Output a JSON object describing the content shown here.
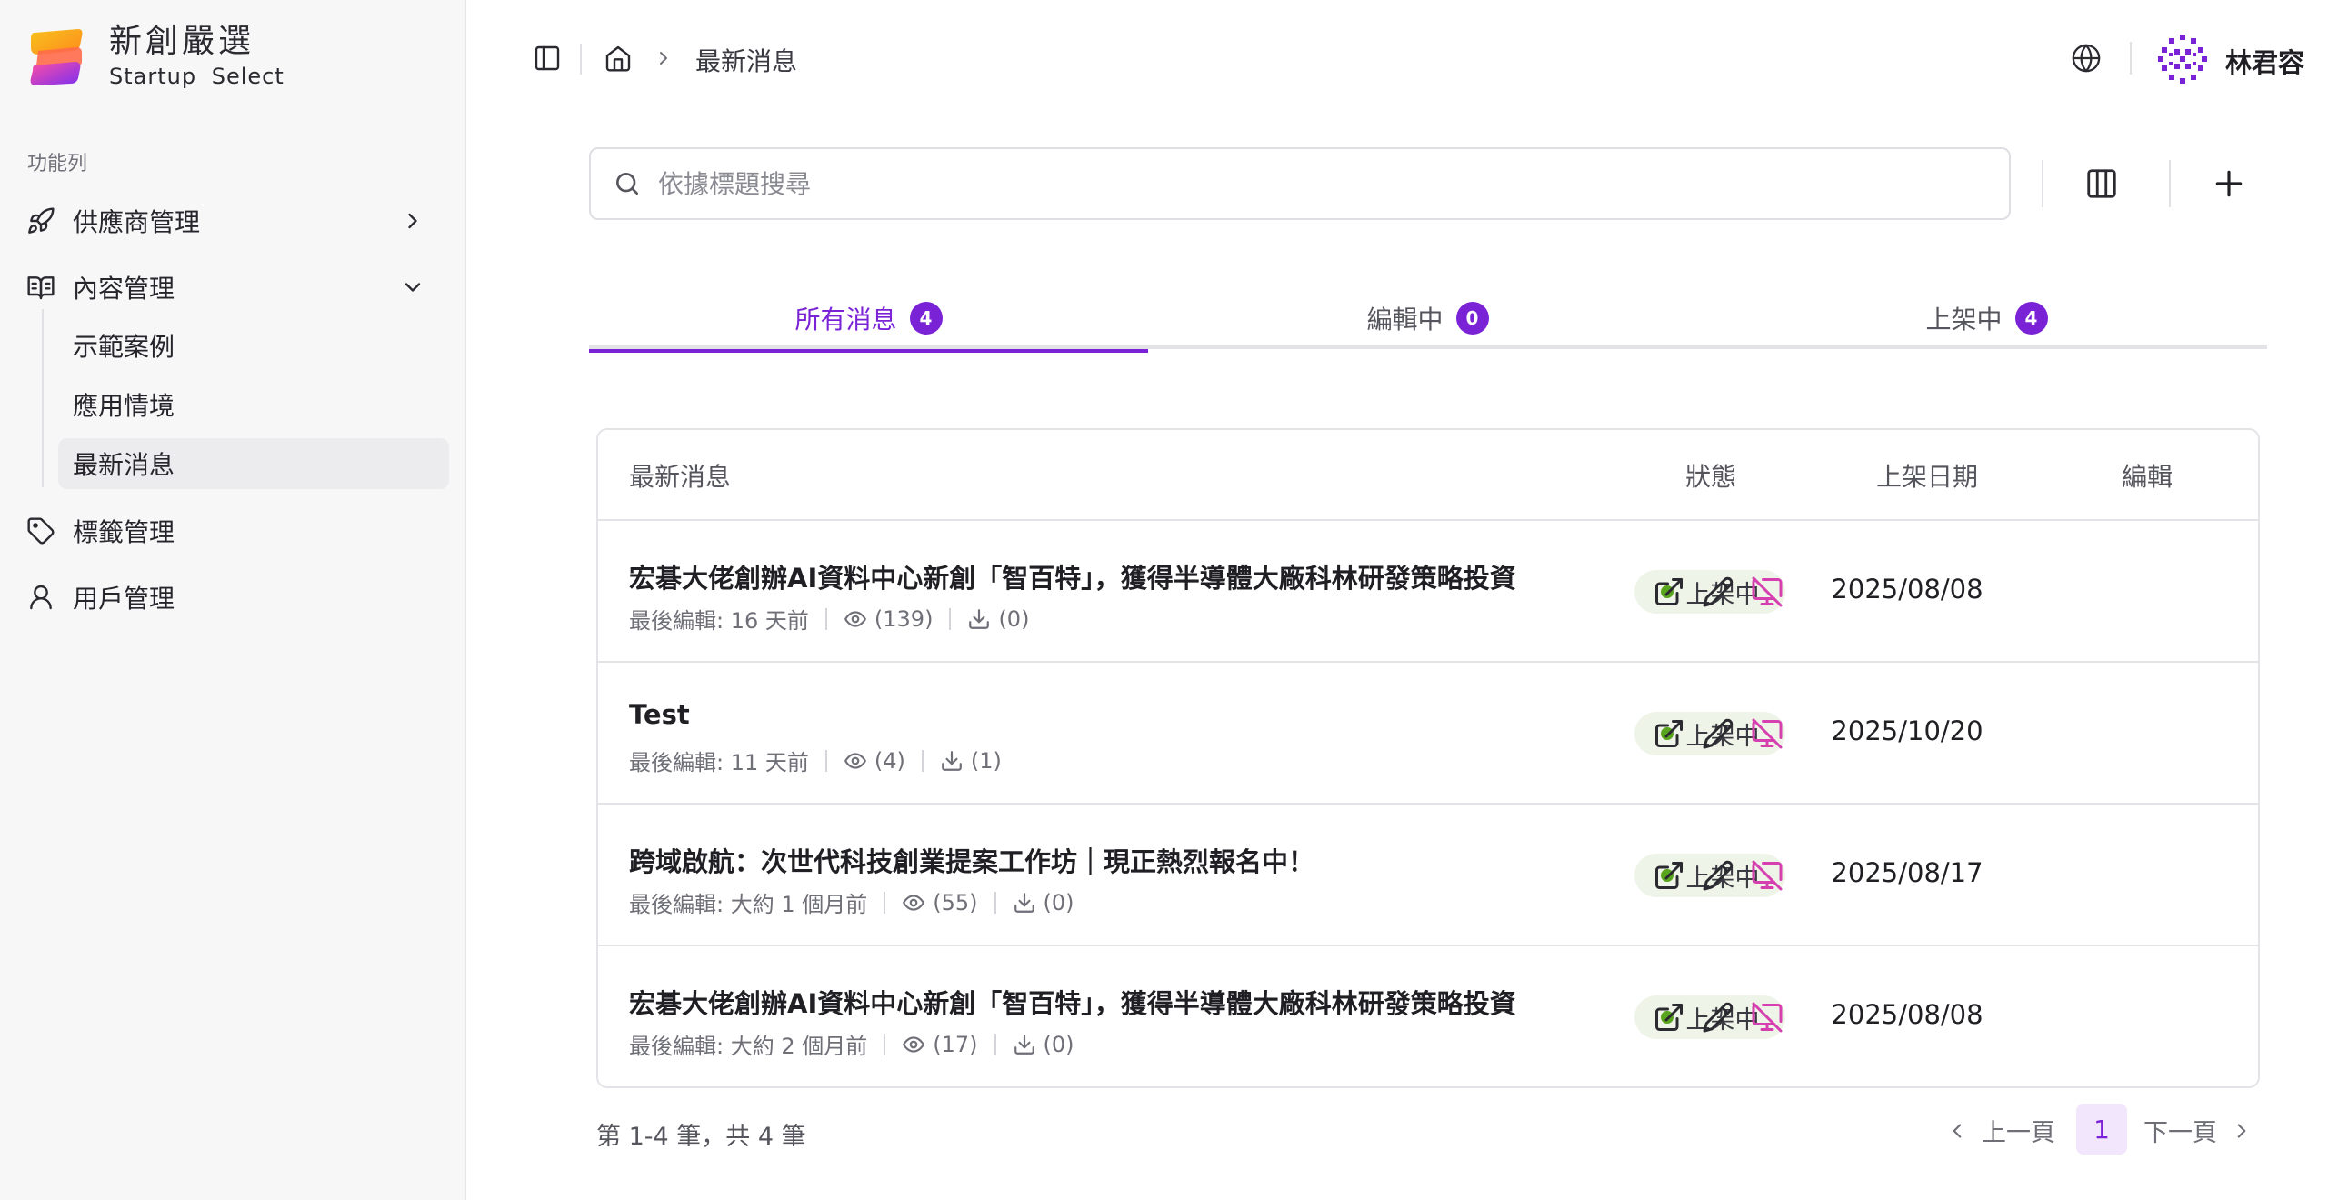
{
  "brand": {
    "name_cn": "新創嚴選",
    "name_en": "Startup  Select"
  },
  "sidebar": {
    "section_label": "功能列",
    "items": [
      {
        "label": "供應商管理",
        "icon": "rocket-icon",
        "expanded": false
      },
      {
        "label": "內容管理",
        "icon": "book-icon",
        "expanded": true,
        "children": [
          {
            "label": "示範案例"
          },
          {
            "label": "應用情境"
          },
          {
            "label": "最新消息",
            "active": true
          }
        ]
      },
      {
        "label": "標籤管理",
        "icon": "tag-icon"
      },
      {
        "label": "用戶管理",
        "icon": "user-icon"
      }
    ]
  },
  "header": {
    "breadcrumb": "最新消息",
    "user_name": "林君容"
  },
  "search": {
    "placeholder": "依據標題搜尋",
    "value": ""
  },
  "tabs": [
    {
      "label": "所有消息",
      "count": "4",
      "active": true
    },
    {
      "label": "編輯中",
      "count": "0",
      "active": false
    },
    {
      "label": "上架中",
      "count": "4",
      "active": false
    }
  ],
  "table": {
    "columns": [
      "最新消息",
      "狀態",
      "上架日期",
      "編輯"
    ],
    "meta_prefix": "最後編輯: ",
    "rows": [
      {
        "title": "宏碁大佬創辦AI資料中心新創「智百特」，獲得半導體大廠科林研發策略投資",
        "edited": "16 天前",
        "views": "(139)",
        "downloads": "(0)",
        "status": "上架中",
        "date": "2025/08/08"
      },
      {
        "title": "Test",
        "edited": "11 天前",
        "views": "(4)",
        "downloads": "(1)",
        "status": "上架中",
        "date": "2025/10/20"
      },
      {
        "title": "跨域啟航：次世代科技創業提案工作坊｜現正熱烈報名中！",
        "edited": "大約 1 個月前",
        "views": "(55)",
        "downloads": "(0)",
        "status": "上架中",
        "date": "2025/08/17"
      },
      {
        "title": "宏碁大佬創辦AI資料中心新創「智百特」，獲得半導體大廠科林研發策略投資",
        "edited": "大約 2 個月前",
        "views": "(17)",
        "downloads": "(0)",
        "status": "上架中",
        "date": "2025/08/08"
      }
    ]
  },
  "footer": {
    "summary": "第 1-4 筆，共 4 筆",
    "prev": "上一頁",
    "next": "下一頁",
    "page": "1"
  },
  "colors": {
    "accent": "#7a22d6",
    "status_dot": "#5aa51e",
    "unpublish_icon": "#d63fb0"
  }
}
